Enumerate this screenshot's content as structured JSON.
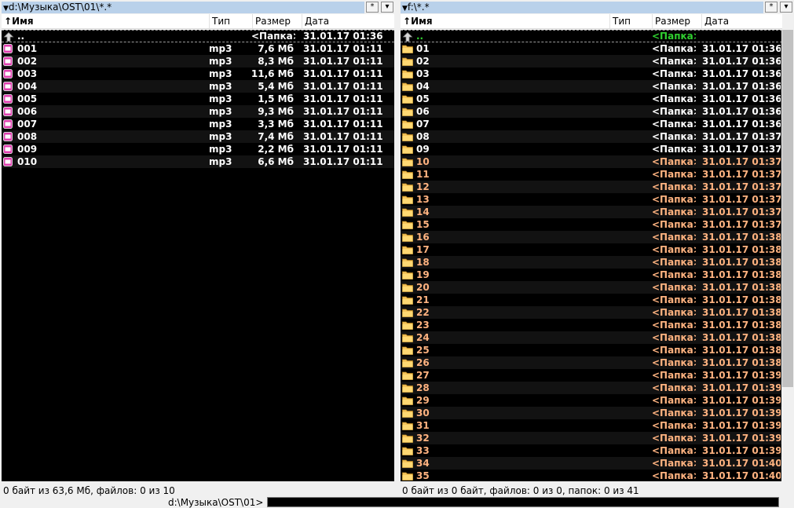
{
  "colors": {
    "file_mp3": "#ffffff",
    "folder_orange": "#ffb380",
    "folder_white": "#ffffff",
    "up_green": "#30d030",
    "panel_bg": "#000000",
    "alt_row_bg": "#121212"
  },
  "icons": {
    "updir": "up-arrow-icon",
    "file": "mp3-file-icon",
    "folder": "folder-icon",
    "sort": "sort-arrow-up-icon",
    "menu": "chevron-down-icon",
    "star": "asterisk-icon"
  },
  "left": {
    "path": "d:\\Музыка\\OST\\01\\*.*",
    "star_label": "*",
    "menu_label": "▾",
    "columns": [
      "Имя",
      "Тип",
      "Размер",
      "Дата"
    ],
    "sort_arrow": "↑",
    "up_row": {
      "name": "..",
      "size": "<Папка>",
      "date": "31.01.17 01:36"
    },
    "files": [
      {
        "name": "001",
        "type": "mp3",
        "size": "7,6 Мб",
        "date": "31.01.17 01:11"
      },
      {
        "name": "002",
        "type": "mp3",
        "size": "8,3 Мб",
        "date": "31.01.17 01:11"
      },
      {
        "name": "003",
        "type": "mp3",
        "size": "11,6 Мб",
        "date": "31.01.17 01:11"
      },
      {
        "name": "004",
        "type": "mp3",
        "size": "5,4 Мб",
        "date": "31.01.17 01:11"
      },
      {
        "name": "005",
        "type": "mp3",
        "size": "1,5 Мб",
        "date": "31.01.17 01:11"
      },
      {
        "name": "006",
        "type": "mp3",
        "size": "9,3 Мб",
        "date": "31.01.17 01:11"
      },
      {
        "name": "007",
        "type": "mp3",
        "size": "3,3 Мб",
        "date": "31.01.17 01:11"
      },
      {
        "name": "008",
        "type": "mp3",
        "size": "7,4 Мб",
        "date": "31.01.17 01:11"
      },
      {
        "name": "009",
        "type": "mp3",
        "size": "2,2 Мб",
        "date": "31.01.17 01:11"
      },
      {
        "name": "010",
        "type": "mp3",
        "size": "6,6 Мб",
        "date": "31.01.17 01:11"
      }
    ],
    "status": "0 байт из 63,6 Мб, файлов: 0 из 10"
  },
  "right": {
    "path": "f:\\*.*",
    "star_label": "*",
    "menu_label": "▾",
    "columns": [
      "Имя",
      "Тип",
      "Размер",
      "Дата"
    ],
    "sort_arrow": "↑",
    "up_row": {
      "name": "..",
      "size": "<Папка>",
      "date": ""
    },
    "folders": [
      {
        "name": "01",
        "size": "<Папка>",
        "date": "31.01.17 01:36",
        "style": "white"
      },
      {
        "name": "02",
        "size": "<Папка>",
        "date": "31.01.17 01:36",
        "style": "white"
      },
      {
        "name": "03",
        "size": "<Папка>",
        "date": "31.01.17 01:36",
        "style": "white"
      },
      {
        "name": "04",
        "size": "<Папка>",
        "date": "31.01.17 01:36",
        "style": "white"
      },
      {
        "name": "05",
        "size": "<Папка>",
        "date": "31.01.17 01:36",
        "style": "white"
      },
      {
        "name": "06",
        "size": "<Папка>",
        "date": "31.01.17 01:36",
        "style": "white"
      },
      {
        "name": "07",
        "size": "<Папка>",
        "date": "31.01.17 01:36",
        "style": "white"
      },
      {
        "name": "08",
        "size": "<Папка>",
        "date": "31.01.17 01:37",
        "style": "white"
      },
      {
        "name": "09",
        "size": "<Папка>",
        "date": "31.01.17 01:37",
        "style": "white"
      },
      {
        "name": "10",
        "size": "<Папка>",
        "date": "31.01.17 01:37",
        "style": "orange"
      },
      {
        "name": "11",
        "size": "<Папка>",
        "date": "31.01.17 01:37",
        "style": "orange"
      },
      {
        "name": "12",
        "size": "<Папка>",
        "date": "31.01.17 01:37",
        "style": "orange"
      },
      {
        "name": "13",
        "size": "<Папка>",
        "date": "31.01.17 01:37",
        "style": "orange"
      },
      {
        "name": "14",
        "size": "<Папка>",
        "date": "31.01.17 01:37",
        "style": "orange"
      },
      {
        "name": "15",
        "size": "<Папка>",
        "date": "31.01.17 01:37",
        "style": "orange"
      },
      {
        "name": "16",
        "size": "<Папка>",
        "date": "31.01.17 01:38",
        "style": "orange"
      },
      {
        "name": "17",
        "size": "<Папка>",
        "date": "31.01.17 01:38",
        "style": "orange"
      },
      {
        "name": "18",
        "size": "<Папка>",
        "date": "31.01.17 01:38",
        "style": "orange"
      },
      {
        "name": "19",
        "size": "<Папка>",
        "date": "31.01.17 01:38",
        "style": "orange"
      },
      {
        "name": "20",
        "size": "<Папка>",
        "date": "31.01.17 01:38",
        "style": "orange"
      },
      {
        "name": "21",
        "size": "<Папка>",
        "date": "31.01.17 01:38",
        "style": "orange"
      },
      {
        "name": "22",
        "size": "<Папка>",
        "date": "31.01.17 01:38",
        "style": "orange"
      },
      {
        "name": "23",
        "size": "<Папка>",
        "date": "31.01.17 01:38",
        "style": "orange"
      },
      {
        "name": "24",
        "size": "<Папка>",
        "date": "31.01.17 01:38",
        "style": "orange"
      },
      {
        "name": "25",
        "size": "<Папка>",
        "date": "31.01.17 01:38",
        "style": "orange"
      },
      {
        "name": "26",
        "size": "<Папка>",
        "date": "31.01.17 01:38",
        "style": "orange"
      },
      {
        "name": "27",
        "size": "<Папка>",
        "date": "31.01.17 01:39",
        "style": "orange"
      },
      {
        "name": "28",
        "size": "<Папка>",
        "date": "31.01.17 01:39",
        "style": "orange"
      },
      {
        "name": "29",
        "size": "<Папка>",
        "date": "31.01.17 01:39",
        "style": "orange"
      },
      {
        "name": "30",
        "size": "<Папка>",
        "date": "31.01.17 01:39",
        "style": "orange"
      },
      {
        "name": "31",
        "size": "<Папка>",
        "date": "31.01.17 01:39",
        "style": "orange"
      },
      {
        "name": "32",
        "size": "<Папка>",
        "date": "31.01.17 01:39",
        "style": "orange"
      },
      {
        "name": "33",
        "size": "<Папка>",
        "date": "31.01.17 01:39",
        "style": "orange"
      },
      {
        "name": "34",
        "size": "<Папка>",
        "date": "31.01.17 01:40",
        "style": "orange"
      },
      {
        "name": "35",
        "size": "<Папка>",
        "date": "31.01.17 01:40",
        "style": "orange"
      }
    ],
    "status": "0 байт из 0 байт, файлов: 0 из 0, папок: 0 из 41"
  },
  "cmdline": {
    "prompt": "d:\\Музыка\\OST\\01>",
    "value": ""
  }
}
